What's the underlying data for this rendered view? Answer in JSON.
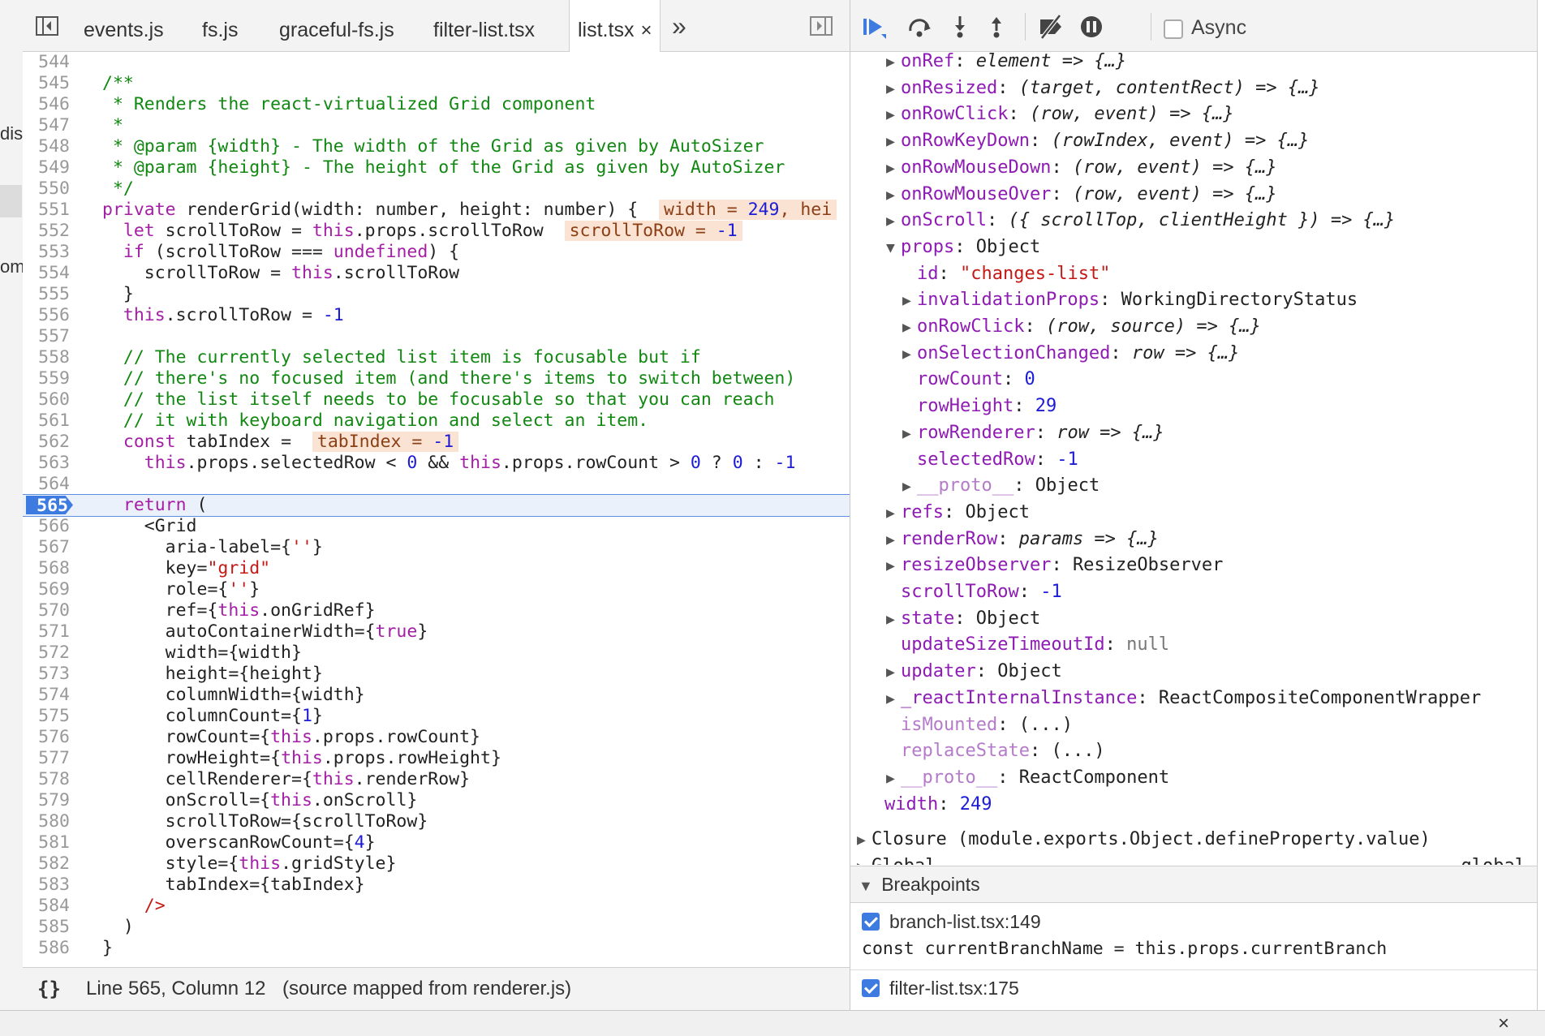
{
  "left_strip": {
    "fragments": [
      "dis",
      "om"
    ]
  },
  "tabs": [
    {
      "label": "events.js"
    },
    {
      "label": "fs.js"
    },
    {
      "label": "graceful-fs.js"
    },
    {
      "label": "filter-list.tsx"
    },
    {
      "label": "list.tsx",
      "close": "×"
    }
  ],
  "tab_overflow": "»",
  "code_lines": [
    {
      "n": "544",
      "html": ""
    },
    {
      "n": "545",
      "html": "<span class='c'>/**</span>"
    },
    {
      "n": "546",
      "html": "<span class='c'> * Renders the react-virtualized Grid component</span>"
    },
    {
      "n": "547",
      "html": "<span class='c'> *</span>"
    },
    {
      "n": "548",
      "html": "<span class='c'> * @param {width} - The width of the Grid as given by AutoSizer</span>"
    },
    {
      "n": "549",
      "html": "<span class='c'> * @param {height} - The height of the Grid as given by AutoSizer</span>"
    },
    {
      "n": "550",
      "html": "<span class='c'> */</span>"
    },
    {
      "n": "551",
      "html": "<span class='k'>private</span> renderGrid(width: number, height: number) {  <span class='inl'>width = <span class='n'>249</span>, hei</span>"
    },
    {
      "n": "552",
      "html": "  <span class='k'>let</span> scrollToRow = <span class='k'>this</span>.props.scrollToRow  <span class='inl'>scrollToRow = <span class='n'>-1</span></span>"
    },
    {
      "n": "553",
      "html": "  <span class='k'>if</span> (scrollToRow === <span class='k'>undefined</span>) {"
    },
    {
      "n": "554",
      "html": "    scrollToRow = <span class='k'>this</span>.scrollToRow"
    },
    {
      "n": "555",
      "html": "  }"
    },
    {
      "n": "556",
      "html": "  <span class='k'>this</span>.scrollToRow = <span class='n'>-1</span>"
    },
    {
      "n": "557",
      "html": ""
    },
    {
      "n": "558",
      "html": "  <span class='c'>// The currently selected list item is focusable but if</span>"
    },
    {
      "n": "559",
      "html": "  <span class='c'>// there's no focused item (and there's items to switch between)</span>"
    },
    {
      "n": "560",
      "html": "  <span class='c'>// the list itself needs to be focusable so that you can reach</span>"
    },
    {
      "n": "561",
      "html": "  <span class='c'>// it with keyboard navigation and select an item.</span>"
    },
    {
      "n": "562",
      "html": "  <span class='k'>const</span> tabIndex =  <span class='inl'>tabIndex = <span class='n'>-1</span></span>"
    },
    {
      "n": "563",
      "html": "    <span class='k'>this</span>.props.selectedRow &lt; <span class='n'>0</span> &amp;&amp; <span class='k'>this</span>.props.rowCount &gt; <span class='n'>0</span> ? <span class='n'>0</span> : <span class='n'>-1</span>"
    },
    {
      "n": "564",
      "html": ""
    },
    {
      "n": "565",
      "html": "  <span class='k'>return</span> (",
      "current": true
    },
    {
      "n": "566",
      "html": "    &lt;Grid"
    },
    {
      "n": "567",
      "html": "      aria-label={<span class='s'>''</span>}"
    },
    {
      "n": "568",
      "html": "      key=<span class='s'>\"grid\"</span>"
    },
    {
      "n": "569",
      "html": "      role={<span class='s'>''</span>}"
    },
    {
      "n": "570",
      "html": "      ref={<span class='k'>this</span>.onGridRef}"
    },
    {
      "n": "571",
      "html": "      autoContainerWidth={<span class='k'>true</span>}"
    },
    {
      "n": "572",
      "html": "      width={width}"
    },
    {
      "n": "573",
      "html": "      height={height}"
    },
    {
      "n": "574",
      "html": "      columnWidth={width}"
    },
    {
      "n": "575",
      "html": "      columnCount={<span class='n'>1</span>}"
    },
    {
      "n": "576",
      "html": "      rowCount={<span class='k'>this</span>.props.rowCount}"
    },
    {
      "n": "577",
      "html": "      rowHeight={<span class='k'>this</span>.props.rowHeight}"
    },
    {
      "n": "578",
      "html": "      cellRenderer={<span class='k'>this</span>.renderRow}"
    },
    {
      "n": "579",
      "html": "      onScroll={<span class='k'>this</span>.onScroll}"
    },
    {
      "n": "580",
      "html": "      scrollToRow={scrollToRow}"
    },
    {
      "n": "581",
      "html": "      overscanRowCount={<span class='n'>4</span>}"
    },
    {
      "n": "582",
      "html": "      style={<span class='k'>this</span>.gridStyle}"
    },
    {
      "n": "583",
      "html": "      tabIndex={tabIndex}"
    },
    {
      "n": "584",
      "html": "    <span class='s'>/&gt;</span>"
    },
    {
      "n": "585",
      "html": "  )"
    },
    {
      "n": "586",
      "html": "}"
    }
  ],
  "status": {
    "braces": "{}",
    "position": "Line 565, Column 12",
    "mapped": "(source mapped from renderer.js)"
  },
  "debugger": {
    "async_label": "Async"
  },
  "scope_rows": [
    {
      "indent": 0,
      "tri": "▶",
      "key": "onRef",
      "dim": false,
      "sep": ": ",
      "val": "element => {…}",
      "vt": "fn"
    },
    {
      "indent": 0,
      "tri": "▶",
      "key": "onResized",
      "dim": false,
      "sep": ": ",
      "val": "(target, contentRect) => {…}",
      "vt": "fn"
    },
    {
      "indent": 0,
      "tri": "▶",
      "key": "onRowClick",
      "dim": false,
      "sep": ": ",
      "val": "(row, event) => {…}",
      "vt": "fn"
    },
    {
      "indent": 0,
      "tri": "▶",
      "key": "onRowKeyDown",
      "dim": false,
      "sep": ": ",
      "val": "(rowIndex, event) => {…}",
      "vt": "fn"
    },
    {
      "indent": 0,
      "tri": "▶",
      "key": "onRowMouseDown",
      "dim": false,
      "sep": ": ",
      "val": "(row, event) => {…}",
      "vt": "fn"
    },
    {
      "indent": 0,
      "tri": "▶",
      "key": "onRowMouseOver",
      "dim": false,
      "sep": ": ",
      "val": "(row, event) => {…}",
      "vt": "fn"
    },
    {
      "indent": 0,
      "tri": "▶",
      "key": "onScroll",
      "dim": false,
      "sep": ": ",
      "val": "({ scrollTop, clientHeight }) => {…}",
      "vt": "fn"
    },
    {
      "indent": 0,
      "tri": "▼",
      "key": "props",
      "dim": false,
      "sep": ": ",
      "val": "Object",
      "vt": "obj"
    },
    {
      "indent": 1,
      "tri": "",
      "key": "id",
      "dim": false,
      "sep": ": ",
      "val": "\"changes-list\"",
      "vt": "str"
    },
    {
      "indent": 1,
      "tri": "▶",
      "key": "invalidationProps",
      "dim": false,
      "sep": ": ",
      "val": "WorkingDirectoryStatus",
      "vt": "obj"
    },
    {
      "indent": 1,
      "tri": "▶",
      "key": "onRowClick",
      "dim": false,
      "sep": ": ",
      "val": "(row, source) => {…}",
      "vt": "fn"
    },
    {
      "indent": 1,
      "tri": "▶",
      "key": "onSelectionChanged",
      "dim": false,
      "sep": ": ",
      "val": "row => {…}",
      "vt": "fn"
    },
    {
      "indent": 1,
      "tri": "",
      "key": "rowCount",
      "dim": false,
      "sep": ": ",
      "val": "0",
      "vt": "num"
    },
    {
      "indent": 1,
      "tri": "",
      "key": "rowHeight",
      "dim": false,
      "sep": ": ",
      "val": "29",
      "vt": "num"
    },
    {
      "indent": 1,
      "tri": "▶",
      "key": "rowRenderer",
      "dim": false,
      "sep": ": ",
      "val": "row => {…}",
      "vt": "fn"
    },
    {
      "indent": 1,
      "tri": "",
      "key": "selectedRow",
      "dim": false,
      "sep": ": ",
      "val": "-1",
      "vt": "num"
    },
    {
      "indent": 1,
      "tri": "▶",
      "key": "__proto__",
      "dim": true,
      "sep": ": ",
      "val": "Object",
      "vt": "obj"
    },
    {
      "indent": 0,
      "tri": "▶",
      "key": "refs",
      "dim": false,
      "sep": ": ",
      "val": "Object",
      "vt": "obj"
    },
    {
      "indent": 0,
      "tri": "▶",
      "key": "renderRow",
      "dim": false,
      "sep": ": ",
      "val": "params => {…}",
      "vt": "fn"
    },
    {
      "indent": 0,
      "tri": "▶",
      "key": "resizeObserver",
      "dim": false,
      "sep": ": ",
      "val": "ResizeObserver",
      "vt": "obj"
    },
    {
      "indent": 0,
      "tri": "",
      "key": "scrollToRow",
      "dim": false,
      "sep": ": ",
      "val": "-1",
      "vt": "num"
    },
    {
      "indent": 0,
      "tri": "▶",
      "key": "state",
      "dim": false,
      "sep": ": ",
      "val": "Object",
      "vt": "obj"
    },
    {
      "indent": 0,
      "tri": "",
      "key": "updateSizeTimeoutId",
      "dim": false,
      "sep": ": ",
      "val": "null",
      "vt": "nul"
    },
    {
      "indent": 0,
      "tri": "▶",
      "key": "updater",
      "dim": false,
      "sep": ": ",
      "val": "Object",
      "vt": "obj"
    },
    {
      "indent": 0,
      "tri": "▶",
      "key": "_reactInternalInstance",
      "dim": false,
      "sep": ": ",
      "val": "ReactCompositeComponentWrapper",
      "vt": "obj"
    },
    {
      "indent": 0,
      "tri": "",
      "key": "isMounted",
      "dim": true,
      "sep": ": ",
      "val": "(...)",
      "vt": "obj"
    },
    {
      "indent": 0,
      "tri": "",
      "key": "replaceState",
      "dim": true,
      "sep": ": ",
      "val": "(...)",
      "vt": "obj"
    },
    {
      "indent": 0,
      "tri": "▶",
      "key": "__proto__",
      "dim": true,
      "sep": ": ",
      "val": "ReactComponent",
      "vt": "obj"
    },
    {
      "indent": -1,
      "tri": "",
      "key": "width",
      "dim": false,
      "sep": ": ",
      "val": "249",
      "vt": "num"
    }
  ],
  "scope_sections": [
    {
      "tri": "▶",
      "label": "Closure (module.exports.Object.defineProperty.value)",
      "tag": ""
    },
    {
      "tri": "▶",
      "label": "Global",
      "tag": "global"
    }
  ],
  "breakpoints": {
    "header": "Breakpoints",
    "header_tri": "▼",
    "items": [
      {
        "label": "branch-list.tsx:149",
        "code": "const currentBranchName = this.props.currentBranch"
      },
      {
        "label": "filter-list.tsx:175",
        "code": ""
      }
    ]
  },
  "bottom_close": "×"
}
